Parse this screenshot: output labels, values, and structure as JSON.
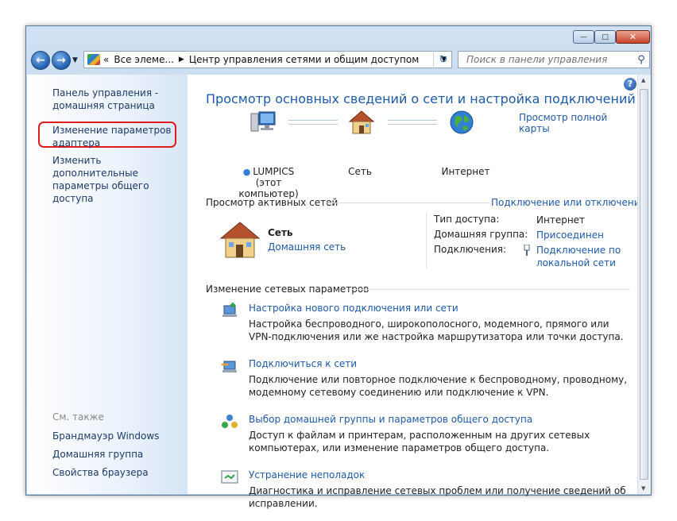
{
  "window": {
    "minimize": "—",
    "maximize": "□",
    "close": "✕"
  },
  "nav": {
    "back_icon": "arrow-left",
    "forward_icon": "arrow-right",
    "breadcrumb": [
      "Все элеме...",
      "Центр управления сетями и общим доступом"
    ],
    "search_placeholder": "Поиск в панели управления"
  },
  "sidebar": {
    "home_line1": "Панель управления -",
    "home_line2": "домашняя страница",
    "adapter_line1": "Изменение параметров",
    "adapter_line2": "адаптера",
    "sharing_line1": "Изменить дополнительные",
    "sharing_line2": "параметры общего доступа",
    "see_also": "См. также",
    "see_also_items": [
      "Брандмауэр Windows",
      "Домашняя группа",
      "Свойства браузера"
    ]
  },
  "main": {
    "title": "Просмотр основных сведений о сети и настройка подключений",
    "full_map": "Просмотр полной карты",
    "map": {
      "computer_name": "LUMPICS",
      "computer_sub": "(этот компьютер)",
      "network": "Сеть",
      "internet": "Интернет"
    },
    "active_header": "Просмотр активных сетей",
    "connect_disconnect": "Подключение или отключение",
    "active_network": {
      "name": "Сеть",
      "type": "Домашняя сеть",
      "access_label": "Тип доступа:",
      "access_value": "Интернет",
      "homegroup_label": "Домашняя группа:",
      "homegroup_value": "Присоединен",
      "connections_label": "Подключения:",
      "connections_value_1": "Подключение по",
      "connections_value_2": "локальной сети"
    },
    "change_header": "Изменение сетевых параметров",
    "tasks": [
      {
        "title": "Настройка нового подключения или сети",
        "desc": "Настройка беспроводного, широкополосного, модемного, прямого или VPN-подключения или же настройка маршрутизатора или точки доступа."
      },
      {
        "title": "Подключиться к сети",
        "desc": "Подключение или повторное подключение к беспроводному, проводному, модемному сетевому соединению или подключение к VPN."
      },
      {
        "title": "Выбор домашней группы и параметров общего доступа",
        "desc": "Доступ к файлам и принтерам, расположенным на других сетевых компьютерах, или изменение параметров общего доступа."
      },
      {
        "title": "Устранение неполадок",
        "desc": "Диагностика и исправление сетевых проблем или получение сведений об исправлении."
      }
    ]
  },
  "colors": {
    "link": "#1e5aa8",
    "highlight": "#e01b1b"
  }
}
